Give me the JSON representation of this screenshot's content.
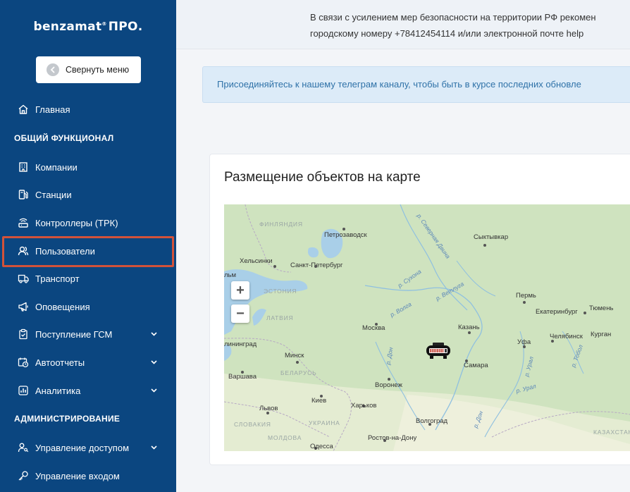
{
  "sidebar": {
    "logo": "benzamat",
    "logo_mark": "®",
    "logo_suffix": "ПРО.",
    "collapse_label": "Свернуть меню",
    "home": "Главная",
    "section_general": "ОБЩИЙ ФУНКЦИОНАЛ",
    "items": [
      {
        "label": "Компании",
        "icon": "building-icon"
      },
      {
        "label": "Станции",
        "icon": "fuel-pump-icon"
      },
      {
        "label": "Контроллеры (ТРК)",
        "icon": "router-icon"
      },
      {
        "label": "Пользователи",
        "icon": "users-icon"
      },
      {
        "label": "Транспорт",
        "icon": "truck-icon"
      },
      {
        "label": "Оповещения",
        "icon": "megaphone-icon"
      },
      {
        "label": "Поступление ГСМ",
        "icon": "clipboard-icon"
      },
      {
        "label": "Автоотчеты",
        "icon": "calendar-clock-icon"
      },
      {
        "label": "Аналитика",
        "icon": "chart-icon"
      }
    ],
    "section_admin": "АДМИНИСТРИРОВАНИЕ",
    "admin_items": [
      {
        "label": "Управление доступом",
        "icon": "user-key-icon"
      },
      {
        "label": "Управление входом",
        "icon": "key-icon"
      }
    ],
    "colors": {
      "bg": "#0b4680",
      "highlight": "#d2523a"
    }
  },
  "topbar": {
    "line1": "В связи с усилением мер безопасности на территории РФ рекомен",
    "line2": "городскому номеру +78412454114 и/или электронной почте help"
  },
  "banner": {
    "text": "Присоединяйтесь к нашему телеграм каналу, чтобы быть в курсе последних обновле"
  },
  "card": {
    "title": "Размещение объектов на карте"
  },
  "map": {
    "zoom_in": "+",
    "zoom_out": "−",
    "labels": {
      "finland": "ФИНЛЯНДИЯ",
      "petrozavodsk": "Петрозаводск",
      "syktyvkar": "Сыктывкар",
      "helsinki": "Хельсинки",
      "spb": "Санкт-Петербург",
      "alm": "льм",
      "estonia": "ЭСТОНИЯ",
      "perm": "Пермь",
      "ekb": "Екатеринбург",
      "tyumen": "Тюмень",
      "latvia": "ЛАТВИЯ",
      "moscow": "Москва",
      "kazan": "Казань",
      "kaliningrad": "лининград",
      "minsk": "Минск",
      "ufa": "Уфа",
      "chelyabinsk": "Челябинск",
      "kurgan": "Курган",
      "belarus": "БЕЛАРУСЬ",
      "samara": "Самара",
      "warsaw": "Варшава",
      "voronezh": "Воронеж",
      "kiev": "Киев",
      "kharkov": "Харьков",
      "lvov": "Львов",
      "slovakia": "СЛОВАКИЯ",
      "ukraine": "УКРАИНА",
      "volgograd": "Волгоград",
      "moldova": "МОЛДОВА",
      "rostov": "Ростов-на-Дону",
      "odessa": "Одесса",
      "kazakhstan": "КАЗАХСТАН",
      "r_northern_dvina": "р. Северная Двина",
      "r_sukhona": "р. Сухона",
      "r_vetluga": "р. Ветлуга",
      "r_volga": "р. Волга",
      "r_don": "р. Дон",
      "r_ural": "р. Урал",
      "r_ural2": "р. Урал",
      "r_tobol": "р. Тобол",
      "r_don2": "р. Дон"
    }
  }
}
